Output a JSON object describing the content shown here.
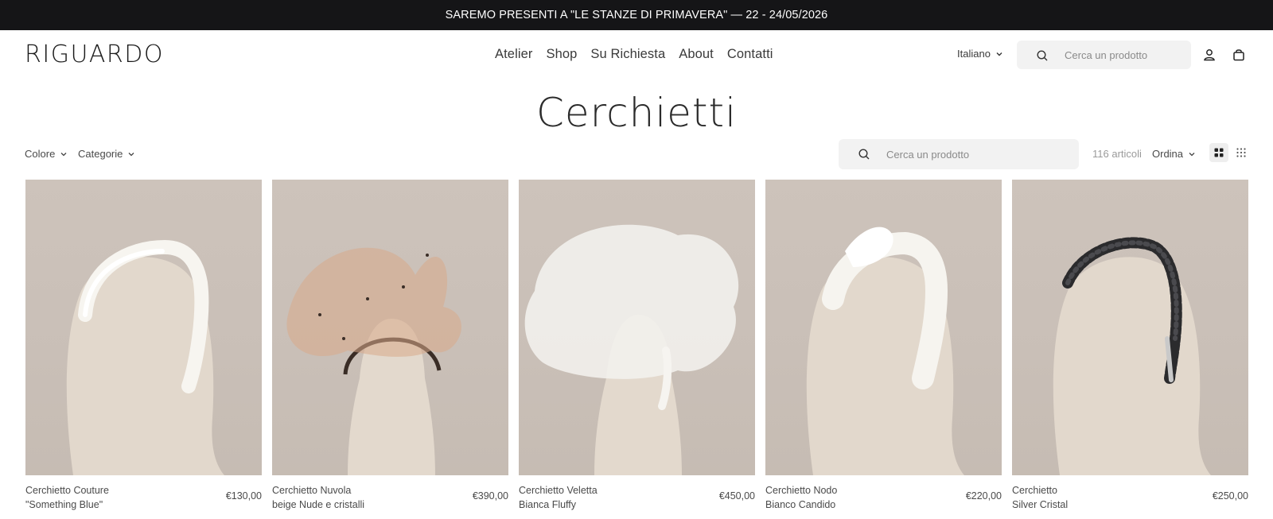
{
  "announcement": "SAREMO PRESENTI A \"LE STANZE DI PRIMAVERA\" — 22 - 24/05/2026",
  "header": {
    "logo": "RIGUARDO",
    "nav": [
      "Atelier",
      "Shop",
      "Su Richiesta",
      "About",
      "Contatti"
    ],
    "language": "Italiano",
    "search_placeholder": "Cerca un prodotto",
    "icons": [
      "search-icon",
      "account-icon",
      "bag-icon"
    ]
  },
  "page": {
    "title": "Cerchietti"
  },
  "toolbar": {
    "filters": [
      "Colore",
      "Categorie"
    ],
    "search_placeholder": "Cerca un prodotto",
    "count": "116 articoli",
    "sort_label": "Ordina",
    "views": [
      "grid-large-icon",
      "grid-small-icon"
    ]
  },
  "products": [
    {
      "line1": "Cerchietto Couture",
      "line2": "\"Something Blue\"",
      "price": "€130,00",
      "style": "padded-white"
    },
    {
      "line1": "Cerchietto Nuvola",
      "line2": "beige Nude e cristalli",
      "price": "€390,00",
      "style": "nude-veil"
    },
    {
      "line1": "Cerchietto Veletta",
      "line2": "Bianca Fluffy",
      "price": "€450,00",
      "style": "white-veil"
    },
    {
      "line1": "Cerchietto Nodo",
      "line2": "Bianco Candido",
      "price": "€220,00",
      "style": "knot-white"
    },
    {
      "line1": "Cerchietto",
      "line2": "Silver Cristal",
      "price": "€250,00",
      "style": "crystal-black"
    }
  ],
  "colors": {
    "announce_bg": "#151517",
    "image_bg": "#cac0b8",
    "mannequin": "#e3dace",
    "search_bg": "#f2f2f2"
  }
}
